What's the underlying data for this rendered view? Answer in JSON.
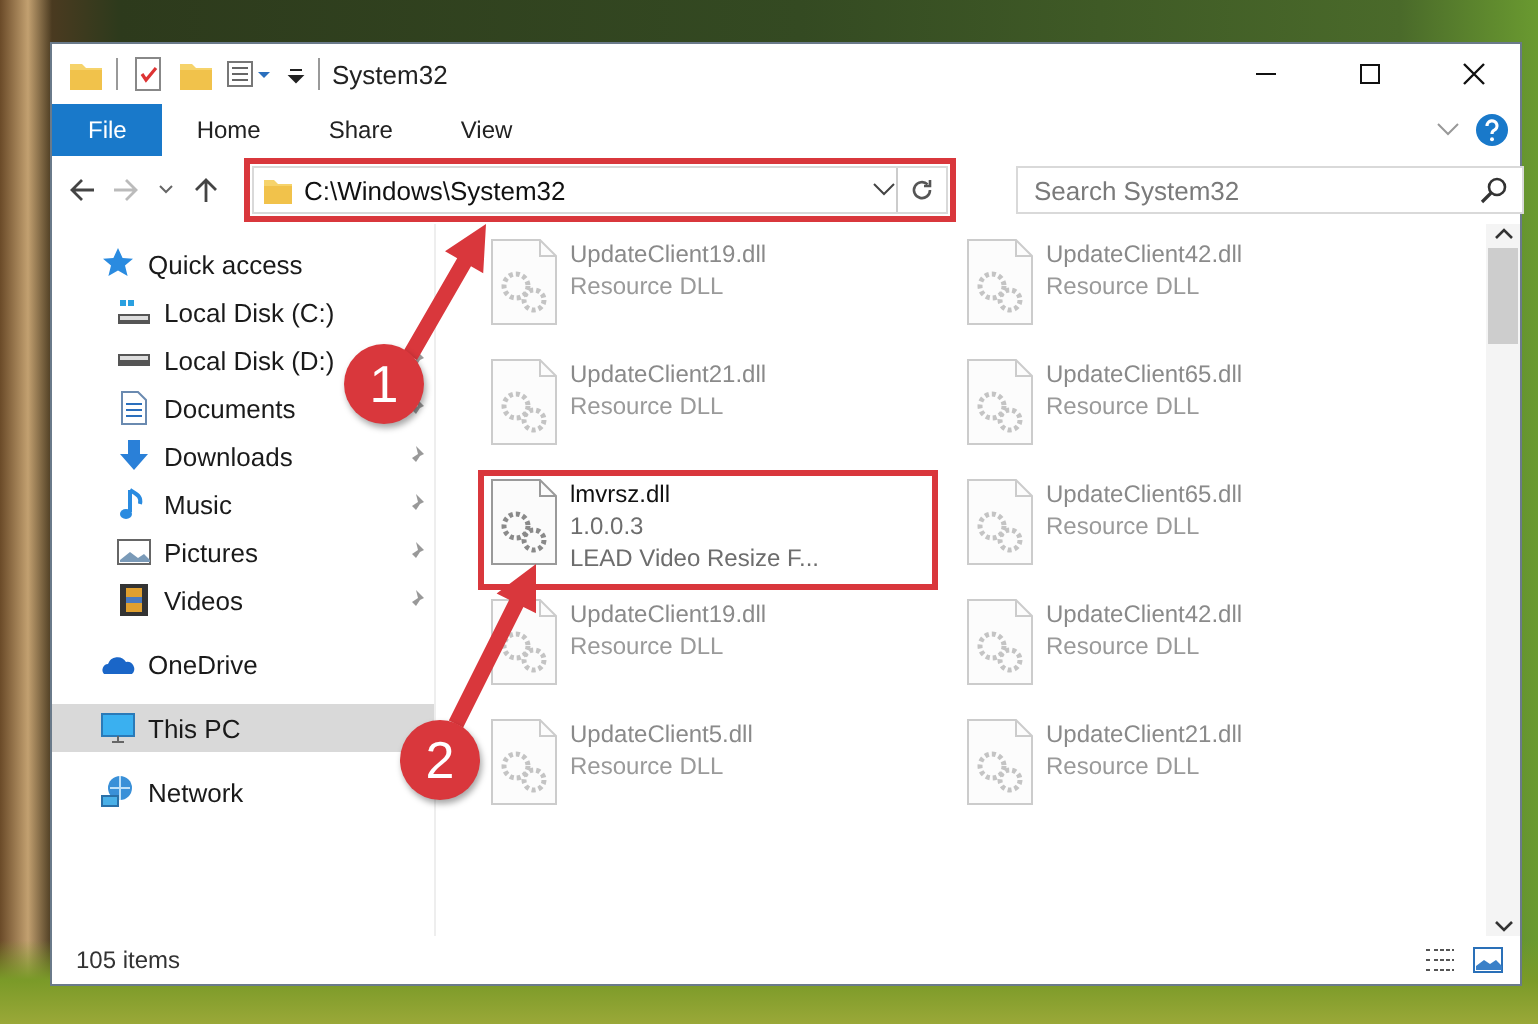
{
  "window": {
    "title": "System32"
  },
  "ribbon": {
    "tabs": [
      {
        "label": "File",
        "kind": "file"
      },
      {
        "label": "Home",
        "kind": "tab"
      },
      {
        "label": "Share",
        "kind": "tab"
      },
      {
        "label": "View",
        "kind": "tab"
      }
    ]
  },
  "address": {
    "path": "C:\\Windows\\System32",
    "highlighted": true
  },
  "search": {
    "placeholder": "Search System32"
  },
  "nav": {
    "items": [
      {
        "label": "Quick access",
        "kind": "quickaccess",
        "selected": false,
        "children": [
          {
            "label": "Local Disk (C:)",
            "kind": "drive-system",
            "pinned": false,
            "selected": false
          },
          {
            "label": "Local Disk (D:)",
            "kind": "drive",
            "pinned": true,
            "selected": false
          },
          {
            "label": "Documents",
            "kind": "documents",
            "pinned": true,
            "selected": false
          },
          {
            "label": "Downloads",
            "kind": "downloads",
            "pinned": true,
            "selected": false
          },
          {
            "label": "Music",
            "kind": "music",
            "pinned": true,
            "selected": false
          },
          {
            "label": "Pictures",
            "kind": "pictures",
            "pinned": true,
            "selected": false
          },
          {
            "label": "Videos",
            "kind": "videos",
            "pinned": true,
            "selected": false
          }
        ]
      },
      {
        "label": "OneDrive",
        "kind": "onedrive",
        "selected": false
      },
      {
        "label": "This PC",
        "kind": "pc",
        "selected": true
      },
      {
        "label": "Network",
        "kind": "network",
        "selected": false
      }
    ]
  },
  "files": [
    {
      "name": "UpdateClient19.dll",
      "details": [
        "Resource DLL"
      ],
      "dimmed": true,
      "highlighted": false
    },
    {
      "name": "UpdateClient42.dll",
      "details": [
        "Resource DLL"
      ],
      "dimmed": true,
      "highlighted": false
    },
    {
      "name": "UpdateClient21.dll",
      "details": [
        "Resource DLL"
      ],
      "dimmed": true,
      "highlighted": false
    },
    {
      "name": "UpdateClient65.dll",
      "details": [
        "Resource DLL"
      ],
      "dimmed": true,
      "highlighted": false
    },
    {
      "name": "lmvrsz.dll",
      "details": [
        "1.0.0.3",
        "LEAD Video Resize F..."
      ],
      "dimmed": false,
      "highlighted": true
    },
    {
      "name": "UpdateClient65.dll",
      "details": [
        "Resource DLL"
      ],
      "dimmed": true,
      "highlighted": false
    },
    {
      "name": "UpdateClient19.dll",
      "details": [
        "Resource DLL"
      ],
      "dimmed": true,
      "highlighted": false
    },
    {
      "name": "UpdateClient42.dll",
      "details": [
        "Resource DLL"
      ],
      "dimmed": true,
      "highlighted": false
    },
    {
      "name": "UpdateClient5.dll",
      "details": [
        "Resource DLL"
      ],
      "dimmed": true,
      "highlighted": false
    },
    {
      "name": "UpdateClient21.dll",
      "details": [
        "Resource DLL"
      ],
      "dimmed": true,
      "highlighted": false
    }
  ],
  "status_bar": {
    "count": "105 items"
  },
  "annotations": [
    {
      "label": "1"
    },
    {
      "label": "2"
    }
  ]
}
